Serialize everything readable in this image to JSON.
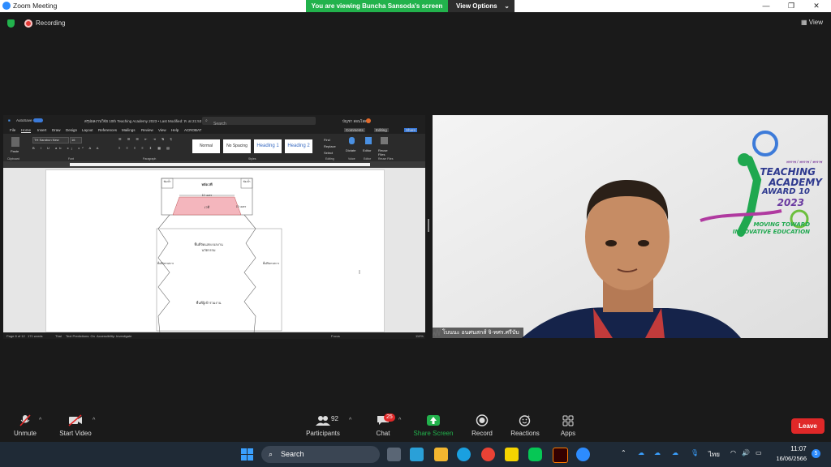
{
  "window": {
    "title": "Zoom Meeting",
    "minimize_glyph": "—",
    "restore_glyph": "❐",
    "close_glyph": "✕"
  },
  "share_banner": {
    "text": "You are viewing Buncha Sansoda's screen",
    "view_options_label": "View Options",
    "view_options_icon": "chevron-down-icon"
  },
  "status": {
    "recording_label": "Recording",
    "view_label": "View"
  },
  "shared_doc": {
    "autosave_label": "AutoSave",
    "doc_title": "สรุปผลงานวิจัย 10th Teaching Academy 2023 • Last Modified: ท. at 21:53",
    "search_placeholder": "Search",
    "user_name": "บัญชา สอนโสดา",
    "menu": [
      "File",
      "Home",
      "Insert",
      "Draw",
      "Design",
      "Layout",
      "References",
      "Mailings",
      "Review",
      "View",
      "Help",
      "ACROBAT"
    ],
    "comments_label": "Comments",
    "editing_label": "Editing",
    "share_label": "Share",
    "font_name": "TH Sarabun New",
    "font_size": "16",
    "paste_label": "Paste",
    "styles": [
      "Normal",
      "No Spacing",
      "Heading 1",
      "Heading 2"
    ],
    "find_label": "Find",
    "replace_label": "Replace",
    "select_label": "Select",
    "dictate_label": "Dictate",
    "editor_label": "Editor",
    "reuse_files_label": "Reuse Files",
    "group_labels": [
      "Clipboard",
      "Font",
      "Paragraph",
      "Styles",
      "Editing",
      "Voice",
      "Editor",
      "Reuse Files"
    ],
    "status_bar": {
      "page": "Page 8 of 12",
      "words": "171 words",
      "language": "Thai",
      "text_predictions": "Text Predictions: On",
      "accessibility": "Accessibility: Investigate",
      "focus": "Focus",
      "zoom": "110%"
    },
    "plan": {
      "stage_label": "หลังเวที",
      "stage_front": "เวที",
      "width_label": "10 เมตร",
      "depth_label": "10 เมตร",
      "left_room": "ห้องน้ำ",
      "right_room": "ห้องน้ำ",
      "center_top": "พื้นที่จัดแสดง ผลงานนวัตกรรม",
      "center_bottom": "พื้นที่ผู้เข้าร่วมงาน",
      "left_side": "พื้นที่นิทรรศการ",
      "right_side": "พื้นที่นิทรรศการ"
    }
  },
  "video": {
    "participant_name": "โบนนะ อนศนสกส์ จิ-ทศร.ศรีบับ",
    "logo_top": "TEACHING",
    "logo_mid": "ACADEMY",
    "logo_award": "AWARD 10",
    "logo_year": "2023",
    "logo_moving": "MOVING TOWARD",
    "logo_innov": "INNOVATIVE EDUCATION",
    "logo_small": "ทรราช / ทรราช / ทรราช"
  },
  "toolbar": {
    "unmute": "Unmute",
    "start_video": "Start Video",
    "participants": "Participants",
    "participants_count": "92",
    "chat": "Chat",
    "chat_badge": "25",
    "share_screen": "Share Screen",
    "record": "Record",
    "reactions": "Reactions",
    "apps": "Apps",
    "leave": "Leave"
  },
  "taskbar": {
    "search_label": "Search",
    "language": "ไทย",
    "time": "11:07",
    "date": "16/06/2566",
    "notification_badge": "5"
  },
  "colors": {
    "share_green": "#22b24c",
    "leave_red": "#e02828",
    "stage_pink": "#f4b6bd",
    "zoom_blue": "#2d8cff"
  }
}
